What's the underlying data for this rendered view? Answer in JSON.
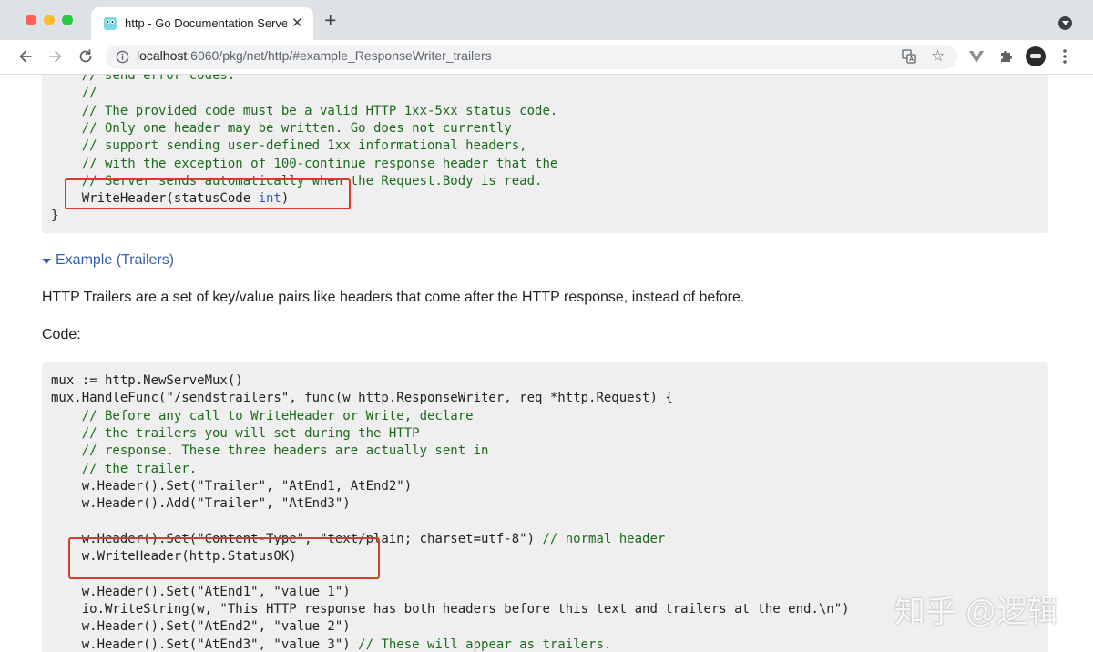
{
  "browser": {
    "tab_title": "http - Go Documentation Serve",
    "url_host": "localhost",
    "url_rest": ":6060/pkg/net/http/#example_ResponseWriter_trailers"
  },
  "code_top": [
    {
      "parts": [
        {
          "c": "cm",
          "t": "    // send error codes."
        }
      ]
    },
    {
      "parts": [
        {
          "c": "cm",
          "t": "    //"
        }
      ]
    },
    {
      "parts": [
        {
          "c": "cm",
          "t": "    // The provided code must be a valid HTTP 1xx-5xx status code."
        }
      ]
    },
    {
      "parts": [
        {
          "c": "cm",
          "t": "    // Only one header may be written. Go does not currently"
        }
      ]
    },
    {
      "parts": [
        {
          "c": "cm",
          "t": "    // support sending user-defined 1xx informational headers,"
        }
      ]
    },
    {
      "parts": [
        {
          "c": "cm",
          "t": "    // with the exception of 100-continue response header that the"
        }
      ]
    },
    {
      "parts": [
        {
          "c": "cm",
          "t": "    // Server sends automatically when the Request.Body is read."
        }
      ]
    },
    {
      "parts": [
        {
          "c": "",
          "t": "    WriteHeader(statusCode "
        },
        {
          "c": "kw",
          "t": "int"
        },
        {
          "c": "",
          "t": ")"
        }
      ]
    },
    {
      "parts": [
        {
          "c": "",
          "t": "}"
        }
      ]
    }
  ],
  "example_title": "Example (Trailers)",
  "description": "HTTP Trailers are a set of key/value pairs like headers that come after the HTTP response, instead of before.",
  "code_label": "Code:",
  "code_example": [
    {
      "parts": [
        {
          "c": "",
          "t": "mux := http.NewServeMux()"
        }
      ]
    },
    {
      "parts": [
        {
          "c": "",
          "t": "mux.HandleFunc(\"/sendstrailers\", func(w http.ResponseWriter, req *http.Request) {"
        }
      ]
    },
    {
      "parts": [
        {
          "c": "cm",
          "t": "    // Before any call to WriteHeader or Write, declare"
        }
      ]
    },
    {
      "parts": [
        {
          "c": "cm",
          "t": "    // the trailers you will set during the HTTP"
        }
      ]
    },
    {
      "parts": [
        {
          "c": "cm",
          "t": "    // response. These three headers are actually sent in"
        }
      ]
    },
    {
      "parts": [
        {
          "c": "cm",
          "t": "    // the trailer."
        }
      ]
    },
    {
      "parts": [
        {
          "c": "",
          "t": "    w.Header().Set(\"Trailer\", \"AtEnd1, AtEnd2\")"
        }
      ]
    },
    {
      "parts": [
        {
          "c": "",
          "t": "    w.Header().Add(\"Trailer\", \"AtEnd3\")"
        }
      ]
    },
    {
      "parts": [
        {
          "c": "",
          "t": ""
        }
      ]
    },
    {
      "parts": [
        {
          "c": "",
          "t": "    w.Header().Set(\"Content-Type\", \"text/plain; charset=utf-8\") "
        },
        {
          "c": "cm",
          "t": "// normal header"
        }
      ]
    },
    {
      "parts": [
        {
          "c": "",
          "t": "    w.WriteHeader(http.StatusOK)"
        }
      ]
    },
    {
      "parts": [
        {
          "c": "",
          "t": ""
        }
      ]
    },
    {
      "parts": [
        {
          "c": "",
          "t": "    w.Header().Set(\"AtEnd1\", \"value 1\")"
        }
      ]
    },
    {
      "parts": [
        {
          "c": "",
          "t": "    io.WriteString(w, \"This HTTP response has both headers before this text and trailers at the end.\\n\")"
        }
      ]
    },
    {
      "parts": [
        {
          "c": "",
          "t": "    w.Header().Set(\"AtEnd2\", \"value 2\")"
        }
      ]
    },
    {
      "parts": [
        {
          "c": "",
          "t": "    w.Header().Set(\"AtEnd3\", \"value 3\") "
        },
        {
          "c": "cm",
          "t": "// These will appear as trailers."
        }
      ]
    }
  ],
  "watermark": "知乎 @逻辑"
}
